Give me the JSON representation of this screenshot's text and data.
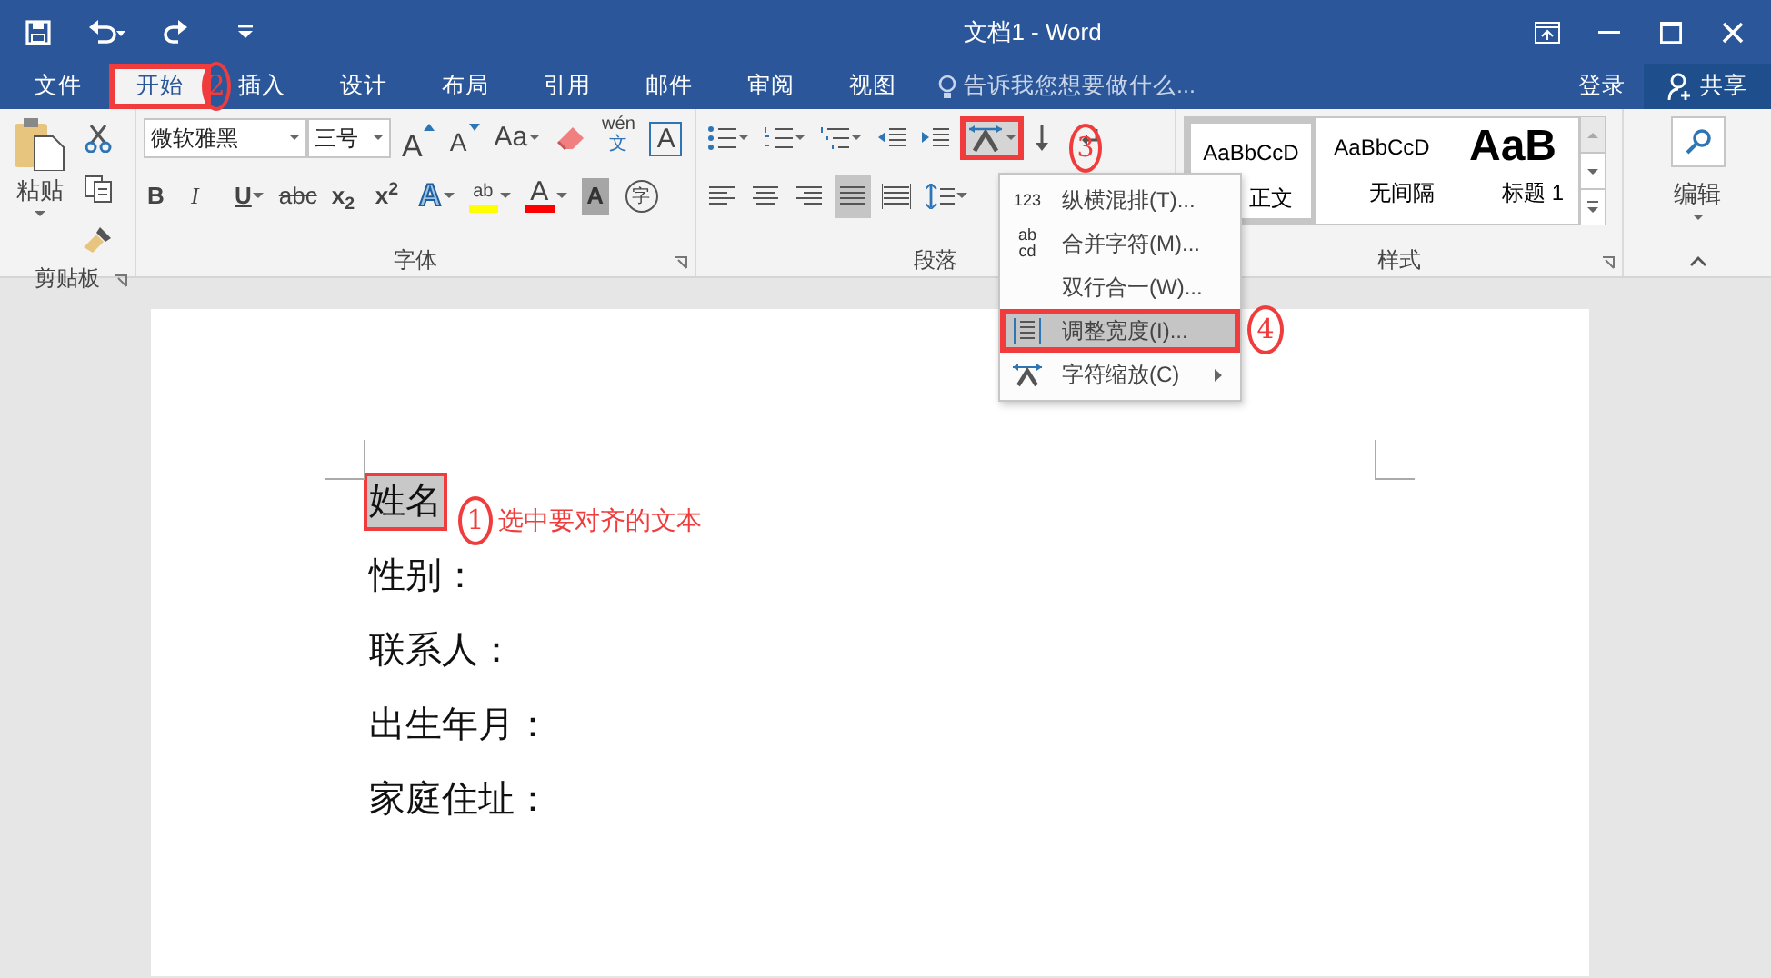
{
  "window": {
    "title": "文档1 - Word"
  },
  "tabs": [
    {
      "label": "文件",
      "selected": false,
      "outlined": false
    },
    {
      "label": "开始",
      "selected": true,
      "outlined": true
    },
    {
      "label": "插入",
      "selected": false,
      "outlined": false
    },
    {
      "label": "设计",
      "selected": false,
      "outlined": false
    },
    {
      "label": "布局",
      "selected": false,
      "outlined": false
    },
    {
      "label": "引用",
      "selected": false,
      "outlined": false
    },
    {
      "label": "邮件",
      "selected": false,
      "outlined": false
    },
    {
      "label": "审阅",
      "selected": false,
      "outlined": false
    },
    {
      "label": "视图",
      "selected": false,
      "outlined": false
    }
  ],
  "tell_me": {
    "placeholder": "告诉我您想要做什么..."
  },
  "account": {
    "sign_in": "登录",
    "share": "共享"
  },
  "ribbon": {
    "clipboard": {
      "paste": "粘贴",
      "label": "剪贴板"
    },
    "font": {
      "name": "微软雅黑",
      "size": "三号",
      "label": "字体",
      "row1": [
        {
          "kind": "grow",
          "label": "A"
        },
        {
          "kind": "shrink",
          "label": "A"
        },
        {
          "kind": "case",
          "label": "Aa"
        },
        {
          "kind": "clear"
        },
        {
          "kind": "phonetic",
          "label": "wén",
          "sub": "文"
        },
        {
          "kind": "border",
          "label": "A"
        }
      ],
      "row2": [
        {
          "kind": "bold",
          "label": "B"
        },
        {
          "kind": "italic",
          "label": "I"
        },
        {
          "kind": "underline",
          "label": "U"
        },
        {
          "kind": "strike",
          "label": "abc"
        },
        {
          "kind": "script",
          "label": "x$_{2}$"
        },
        {
          "kind": "script",
          "label": "x$^{2}$"
        },
        {
          "kind": "effect",
          "label": "A"
        },
        {
          "kind": "highlight",
          "label": "ab",
          "color": "#ffff00"
        },
        {
          "kind": "fontcolor",
          "label": "A",
          "color": "#ff0000"
        },
        {
          "kind": "shading",
          "label": "A"
        },
        {
          "kind": "enclose",
          "label": "字"
        }
      ]
    },
    "paragraph": {
      "label": "段落",
      "width_button_outlined": true,
      "alignments": [
        {
          "selected": false
        },
        {
          "selected": false
        },
        {
          "selected": false
        },
        {
          "selected": true
        },
        {
          "selected": false
        }
      ]
    },
    "styles": {
      "label": "样式",
      "items": [
        {
          "preview": "AaBbCcD",
          "name": "正文",
          "selected": true,
          "heading": false
        },
        {
          "preview": "AaBbCcD",
          "name": "无间隔",
          "selected": false,
          "heading": false
        },
        {
          "preview": "AaB",
          "name": "标题 1",
          "selected": false,
          "heading": true
        }
      ]
    },
    "editing": {
      "label": "编辑"
    }
  },
  "menu": {
    "items": [
      {
        "icon": "123",
        "label": "纵横混排(T)...",
        "selected": false,
        "outlined": false,
        "submenu": false
      },
      {
        "icon_lines": [
          "ab",
          "cd"
        ],
        "label": "合并字符(M)...",
        "selected": false,
        "outlined": false,
        "submenu": false
      },
      {
        "label": "双行合一(W)...",
        "selected": false,
        "outlined": false,
        "submenu": false
      },
      {
        "kind": "width",
        "label": "调整宽度(I)...",
        "selected": true,
        "outlined": true,
        "submenu": false
      },
      {
        "kind": "scale",
        "label": "字符缩放(C)",
        "selected": false,
        "outlined": false,
        "submenu": true
      }
    ]
  },
  "document": {
    "lines": [
      {
        "text": "姓名",
        "selected": true,
        "outlined": true
      },
      {
        "text": "性别：",
        "selected": false,
        "outlined": false
      },
      {
        "text": "联系人：",
        "selected": false,
        "outlined": false
      },
      {
        "text": "出生年月：",
        "selected": false,
        "outlined": false
      },
      {
        "text": "家庭住址：",
        "selected": false,
        "outlined": false
      }
    ]
  },
  "annotations": [
    {
      "number": "1",
      "note": "选中要对齐的文本"
    },
    {
      "number": "2"
    },
    {
      "number": "3"
    },
    {
      "number": "4"
    }
  ]
}
